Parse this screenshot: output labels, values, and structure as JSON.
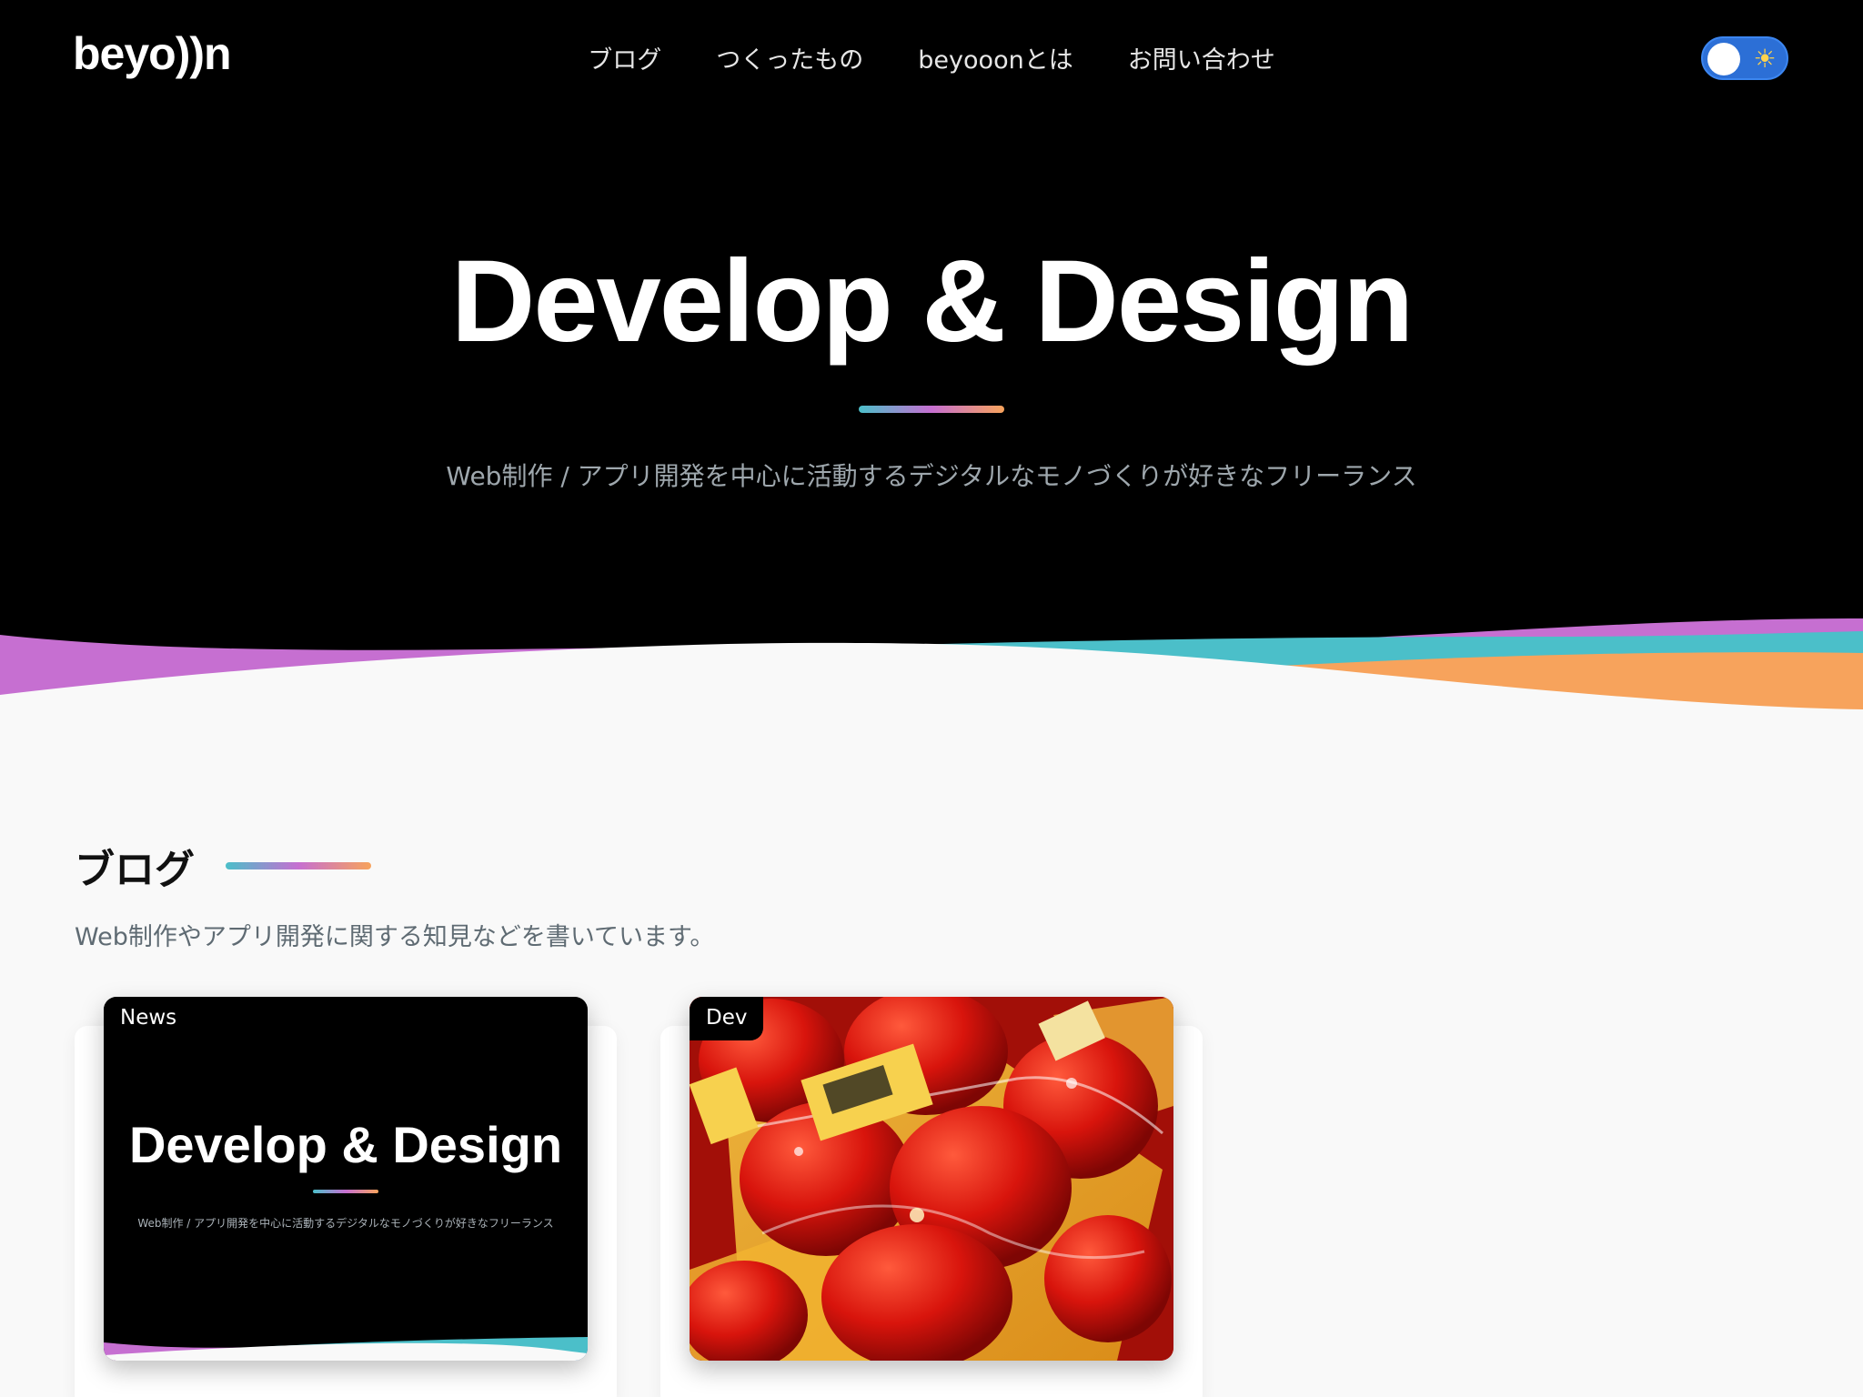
{
  "header": {
    "logo": "beyo))n",
    "nav": [
      "ブログ",
      "つくったもの",
      "beyooonとは",
      "お問い合わせ"
    ],
    "theme_toggle_icon": "sun-icon"
  },
  "hero": {
    "title": "Develop & Design",
    "subtitle": "Web制作 / アプリ開発を中心に活動するデジタルなモノづくりが好きなフリーランス"
  },
  "blog": {
    "title": "ブログ",
    "description": "Web制作やアプリ開発に関する知見などを書いています。",
    "cards": [
      {
        "category": "News",
        "thumb_title": "Develop & Design",
        "thumb_subtitle": "Web制作 / アプリ開発を中心に活動するデジタルなモノづくりが好きなフリーランス"
      },
      {
        "category": "Dev",
        "thumb_image": "red-tomatoes-photo"
      }
    ]
  },
  "colors": {
    "gradient": [
      "#4bbfc9",
      "#c66fd1",
      "#f7a35c"
    ],
    "toggle": "#2c6fd6",
    "background": "#f9f9f9",
    "hero_background": "#000000"
  }
}
